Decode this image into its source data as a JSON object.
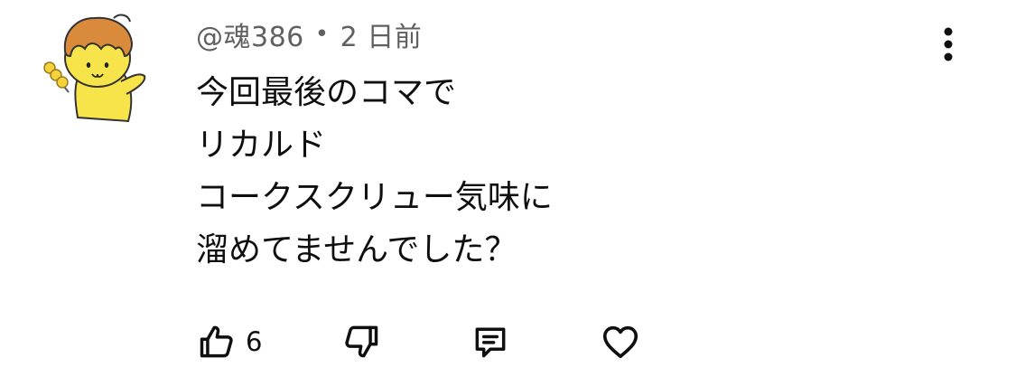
{
  "comment": {
    "author": "@魂386",
    "separator": "•",
    "time": "2 日前",
    "lines": [
      "今回最後のコマで",
      "リカルド",
      "コークスクリュー気味に",
      "溜めてませんでした？"
    ],
    "like_count": "6"
  },
  "icons": {
    "avatar": "mascot-avatar-icon",
    "menu": "more-vert-icon",
    "like": "thumbs-up-icon",
    "dislike": "thumbs-down-icon",
    "reply": "reply-comment-icon",
    "heart": "heart-icon"
  },
  "colors": {
    "text_primary": "#0f0f0f",
    "text_secondary": "#606060",
    "avatar_body": "#f7e34a",
    "avatar_hair": "#d98a3a"
  }
}
